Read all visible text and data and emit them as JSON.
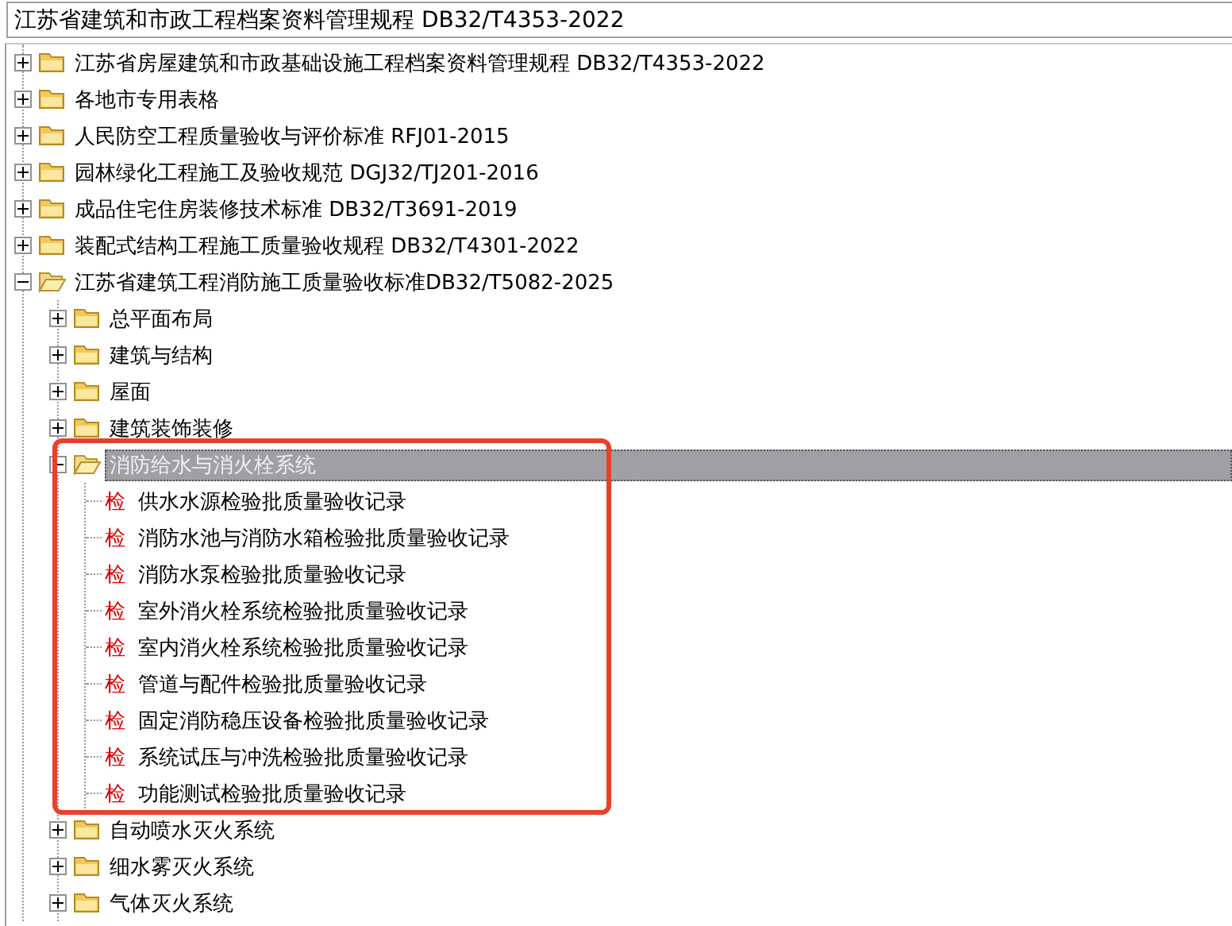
{
  "path_field": {
    "value": "江苏省建筑和市政工程档案资料管理规程 DB32/T4353-2022"
  },
  "tree": [
    {
      "kind": "folder",
      "label": "江苏省房屋建筑和市政基础设施工程档案资料管理规程 DB32/T4353-2022",
      "expanded": false,
      "selected": false
    },
    {
      "kind": "folder",
      "label": "各地市专用表格",
      "expanded": false,
      "selected": false
    },
    {
      "kind": "folder",
      "label": "人民防空工程质量验收与评价标准 RFJ01-2015",
      "expanded": false,
      "selected": false
    },
    {
      "kind": "folder",
      "label": "园林绿化工程施工及验收规范 DGJ32/TJ201-2016",
      "expanded": false,
      "selected": false
    },
    {
      "kind": "folder",
      "label": "成品住宅住房装修技术标准 DB32/T3691-2019",
      "expanded": false,
      "selected": false
    },
    {
      "kind": "folder",
      "label": "装配式结构工程施工质量验收规程 DB32/T4301-2022",
      "expanded": false,
      "selected": false
    },
    {
      "kind": "folder",
      "label": "江苏省建筑工程消防施工质量验收标准DB32/T5082-2025",
      "expanded": true,
      "selected": false,
      "children": [
        {
          "kind": "folder",
          "label": "总平面布局",
          "expanded": false,
          "selected": false
        },
        {
          "kind": "folder",
          "label": "建筑与结构",
          "expanded": false,
          "selected": false
        },
        {
          "kind": "folder",
          "label": "屋面",
          "expanded": false,
          "selected": false
        },
        {
          "kind": "folder",
          "label": "建筑装饰装修",
          "expanded": false,
          "selected": false
        },
        {
          "kind": "folder",
          "label": "消防给水与消火栓系统",
          "expanded": true,
          "selected": true,
          "annotated": true,
          "children": [
            {
              "kind": "record",
              "badge": "检",
              "label": "供水水源检验批质量验收记录",
              "selected": false
            },
            {
              "kind": "record",
              "badge": "检",
              "label": "消防水池与消防水箱检验批质量验收记录",
              "selected": false
            },
            {
              "kind": "record",
              "badge": "检",
              "label": "消防水泵检验批质量验收记录",
              "selected": false
            },
            {
              "kind": "record",
              "badge": "检",
              "label": "室外消火栓系统检验批质量验收记录",
              "selected": false
            },
            {
              "kind": "record",
              "badge": "检",
              "label": "室内消火栓系统检验批质量验收记录",
              "selected": false
            },
            {
              "kind": "record",
              "badge": "检",
              "label": "管道与配件检验批质量验收记录",
              "selected": false
            },
            {
              "kind": "record",
              "badge": "检",
              "label": "固定消防稳压设备检验批质量验收记录",
              "selected": false
            },
            {
              "kind": "record",
              "badge": "检",
              "label": "系统试压与冲洗检验批质量验收记录",
              "selected": false
            },
            {
              "kind": "record",
              "badge": "检",
              "label": "功能测试检验批质量验收记录",
              "selected": false
            }
          ]
        },
        {
          "kind": "folder",
          "label": "自动喷水灭火系统",
          "expanded": false,
          "selected": false
        },
        {
          "kind": "folder",
          "label": "细水雾灭火系统",
          "expanded": false,
          "selected": false
        },
        {
          "kind": "folder",
          "label": "气体灭火系统",
          "expanded": false,
          "selected": false
        }
      ]
    }
  ]
}
